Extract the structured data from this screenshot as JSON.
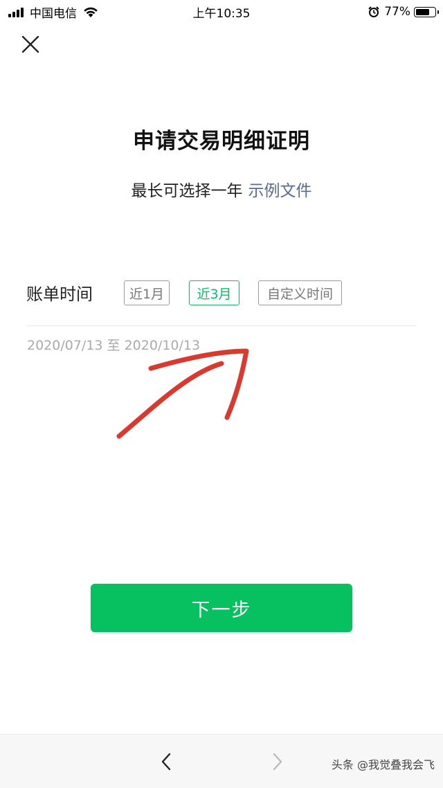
{
  "status_bar": {
    "carrier": "中国电信",
    "time": "上午10:35",
    "battery_percent": "77%",
    "battery_level": 0.77,
    "signal_icon": "signal-bars-icon",
    "wifi_icon": "wifi-icon",
    "alarm_icon": "alarm-icon"
  },
  "header": {
    "close_icon": "close-icon"
  },
  "main": {
    "title": "申请交易明细证明",
    "subtitle": "最长可选择一年",
    "sample_link": "示例文件",
    "bill_time_label": "账单时间",
    "options": [
      {
        "label": "近1月",
        "selected": false
      },
      {
        "label": "近3月",
        "selected": true
      },
      {
        "label": "自定义时间",
        "selected": false
      }
    ],
    "date_range": "2020/07/13 至 2020/10/13",
    "next_button": "下一步"
  },
  "bottom_bar": {
    "back_icon": "chevron-left-icon",
    "forward_icon": "chevron-right-icon",
    "watermark": "头条 @我觉叠我会飞"
  },
  "colors": {
    "accent_green": "#07c160",
    "link_blue": "#576b95",
    "annotation_red": "#d93a30"
  }
}
